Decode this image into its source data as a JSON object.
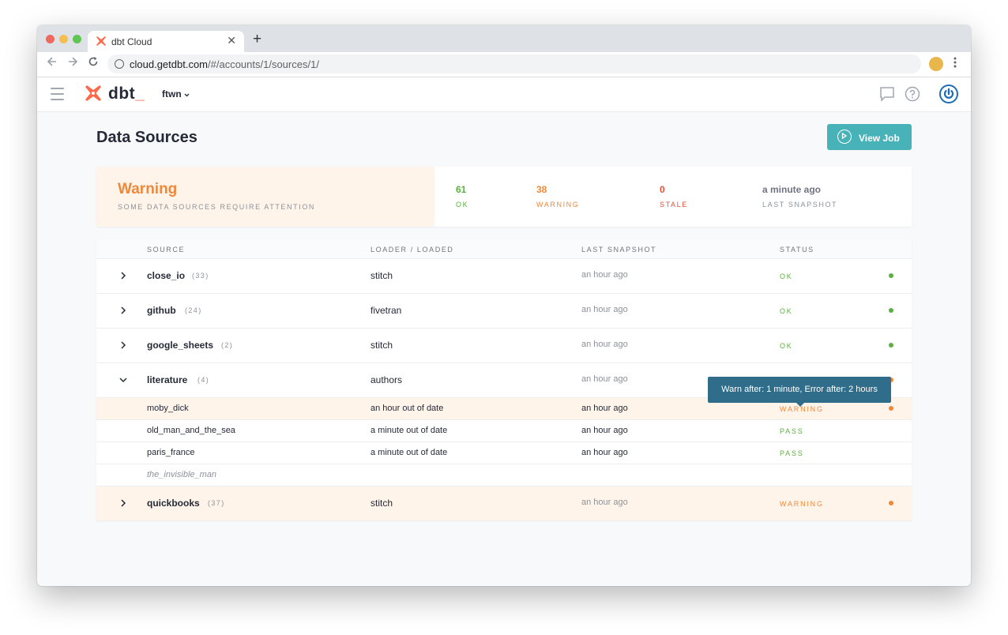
{
  "browser": {
    "tab_title": "dbt Cloud",
    "new_tab_symbol": "+",
    "url_host": "cloud.getdbt.com",
    "url_path": "/#/accounts/1/sources/1/"
  },
  "header": {
    "brand": "dbt",
    "brand_suffix": "_",
    "account": "ftwn"
  },
  "page": {
    "title": "Data Sources",
    "view_job_label": "View Job"
  },
  "summary": {
    "state": "Warning",
    "subtitle": "SOME DATA SOURCES REQUIRE ATTENTION",
    "stats": [
      {
        "value": "61",
        "label": "OK",
        "color": "#5cb040"
      },
      {
        "value": "38",
        "label": "WARNING",
        "color": "#f0883a"
      },
      {
        "value": "0",
        "label": "STALE",
        "color": "#e2503a"
      },
      {
        "value": "a minute ago",
        "label": "LAST SNAPSHOT",
        "color": "#8d9299"
      }
    ]
  },
  "table": {
    "columns": [
      "SOURCE",
      "LOADER / LOADED",
      "LAST SNAPSHOT",
      "STATUS"
    ],
    "sources": [
      {
        "name": "close_io",
        "count": "(33)",
        "loader": "stitch",
        "snapshot": "an hour ago",
        "status": "OK"
      },
      {
        "name": "github",
        "count": "(24)",
        "loader": "fivetran",
        "snapshot": "an hour ago",
        "status": "OK"
      },
      {
        "name": "google_sheets",
        "count": "(2)",
        "loader": "stitch",
        "snapshot": "an hour ago",
        "status": "OK"
      },
      {
        "name": "literature",
        "count": "(4)",
        "loader": "authors",
        "snapshot": "an hour ago",
        "status": "WARNING"
      },
      {
        "name": "quickbooks",
        "count": "(37)",
        "loader": "stitch",
        "snapshot": "an hour ago",
        "status": "WARNING"
      }
    ],
    "tables": [
      {
        "name": "moby_dick",
        "loaded": "an hour out of date",
        "snapshot": "an hour ago",
        "status": "WARNING"
      },
      {
        "name": "old_man_and_the_sea",
        "loaded": "a minute out of date",
        "snapshot": "an hour ago",
        "status": "PASS"
      },
      {
        "name": "paris_france",
        "loaded": "a minute out of date",
        "snapshot": "an hour ago",
        "status": "PASS"
      },
      {
        "name": "the_invisible_man",
        "loaded": "",
        "snapshot": "",
        "status": ""
      }
    ]
  },
  "tooltip": {
    "text": "Warn after: 1 minute, Error after: 2 hours"
  },
  "colors": {
    "ok": "#5cb040",
    "warning": "#f0883a",
    "stale": "#e2503a",
    "accent": "#47b3b8",
    "brand": "#ff694b"
  }
}
